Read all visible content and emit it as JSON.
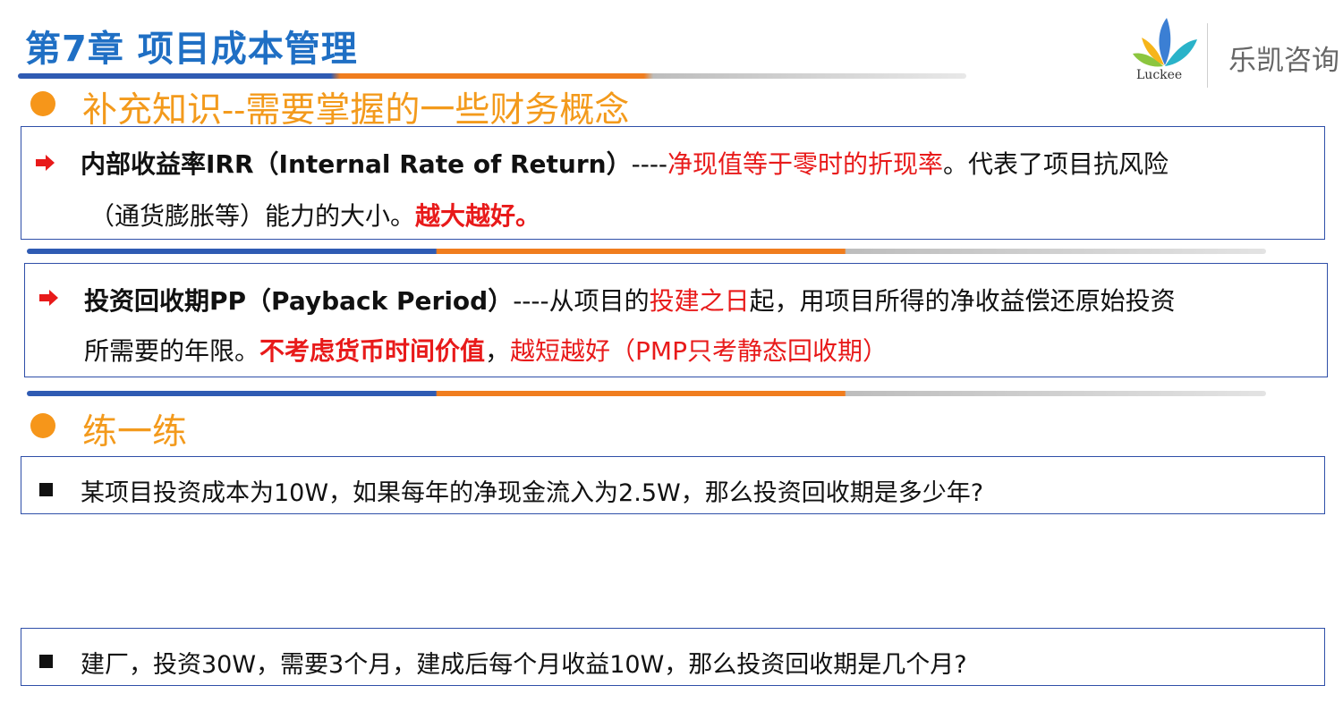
{
  "header": {
    "chapter_title": "第7章 项目成本管理"
  },
  "logo": {
    "brand": "Luckee",
    "company": "乐凯咨询"
  },
  "section1": {
    "heading": "补充知识--需要掌握的一些财务概念"
  },
  "irr": {
    "term": "内部收益率IRR（Internal Rate of Return）",
    "dash": "----",
    "definition": "净现值等于零时的折现率",
    "rest_line1": "。代表了项目抗风险",
    "line2_normal": "（通货膨胀等）能力的大小。",
    "line2_emphasis": "越大越好。"
  },
  "pp": {
    "term": "投资回收期PP（Payback Period）",
    "dash": "----从项目的",
    "highlight1": "投建之日",
    "rest_line1": "起，用项目所得的净收益偿还原始投资",
    "line2_normal": "所需要的年限。",
    "line2_emphasis": "不考虑货币时间价值",
    "comma": "，",
    "line2_red": "越短越好（PMP只考静态回收期）"
  },
  "section2": {
    "heading": "练一练"
  },
  "exercises": [
    {
      "text": "某项目投资成本为10W，如果每年的净现金流入为2.5W，那么投资回收期是多少年?"
    },
    {
      "text": "建厂，投资30W，需要3个月，建成后每个月收益10W，那么投资回收期是几个月?"
    }
  ],
  "colors": {
    "title_blue": "#1f6fc4",
    "heading_orange": "#f39a1c",
    "emphasis_red": "#e81a1a",
    "box_border": "#2f4fa8",
    "bar_blue": "#2f5bb3",
    "bar_orange": "#f07d1e",
    "bar_gray": "#bdbdbd"
  }
}
